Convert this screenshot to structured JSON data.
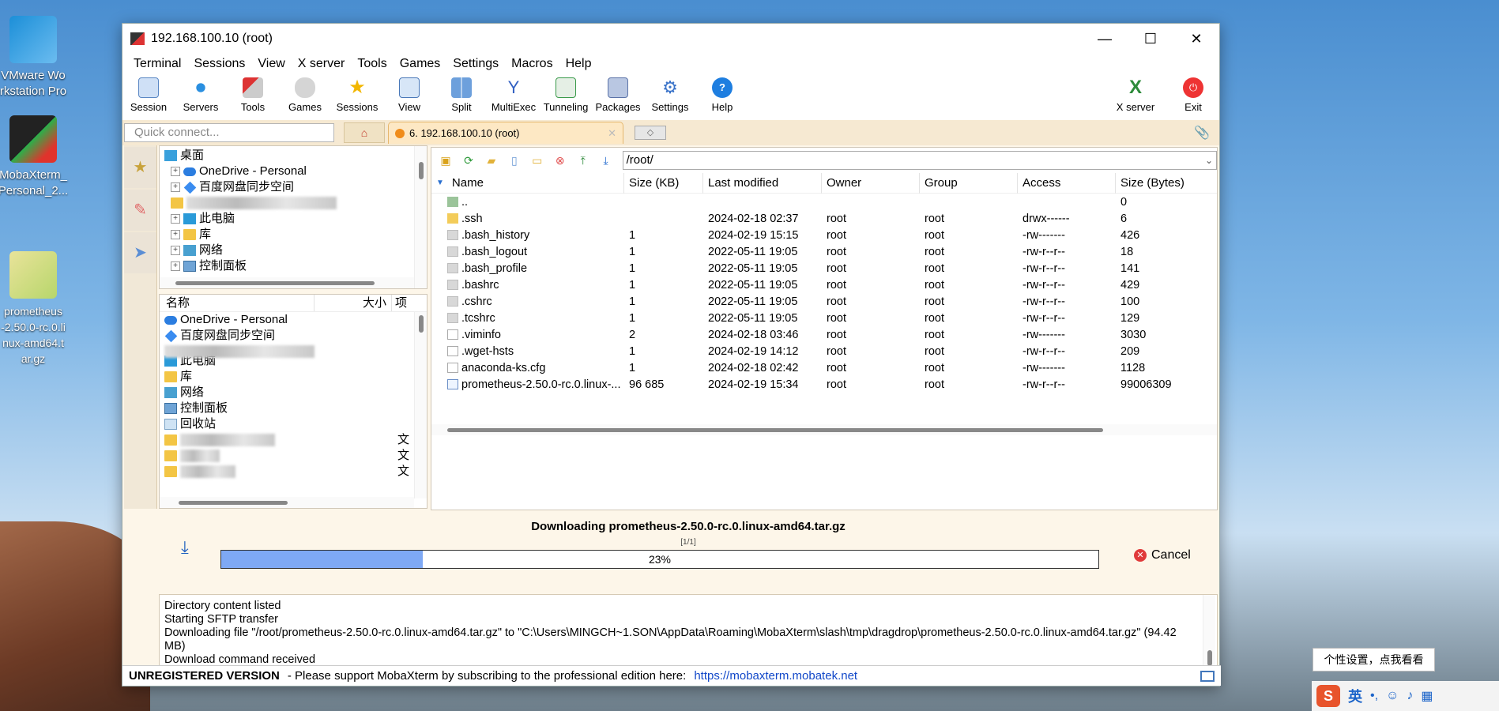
{
  "desktop": {
    "icons": [
      {
        "label": "VMware Wo\nrkstation Pro"
      },
      {
        "label": "MobaXterm_\nPersonal_2..."
      },
      {
        "label": "prometheus\n-2.50.0-rc.0.li\nnux-amd64.t\nar.gz"
      }
    ],
    "tray_tip": "个性设置，点我看看",
    "tray_lang": "英"
  },
  "window": {
    "title": "192.168.100.10 (root)",
    "menu": [
      "Terminal",
      "Sessions",
      "View",
      "X server",
      "Tools",
      "Games",
      "Settings",
      "Macros",
      "Help"
    ],
    "toolbar": [
      "Session",
      "Servers",
      "Tools",
      "Games",
      "Sessions",
      "View",
      "Split",
      "MultiExec",
      "Tunneling",
      "Packages",
      "Settings",
      "Help"
    ],
    "toolbar_right": [
      "X server",
      "Exit"
    ],
    "quick_connect_placeholder": "Quick connect...",
    "session_tab": "6. 192.168.100.10 (root)"
  },
  "left_tree": {
    "items": [
      {
        "label": "桌面",
        "icon": "desktop"
      },
      {
        "label": "OneDrive - Personal",
        "icon": "cloud"
      },
      {
        "label": "百度网盘同步空间",
        "icon": "baidu"
      },
      {
        "label": "此电脑",
        "icon": "pc"
      },
      {
        "label": "库",
        "icon": "folder"
      },
      {
        "label": "网络",
        "icon": "network"
      },
      {
        "label": "控制面板",
        "icon": "control-panel"
      }
    ]
  },
  "left_list": {
    "headers": [
      "名称",
      "大小",
      "项"
    ],
    "items": [
      {
        "label": "OneDrive - Personal",
        "icon": "cloud"
      },
      {
        "label": "百度网盘同步空间",
        "icon": "baidu"
      },
      {
        "label": "此电脑",
        "icon": "pc"
      },
      {
        "label": "库",
        "icon": "folder"
      },
      {
        "label": "网络",
        "icon": "network"
      },
      {
        "label": "控制面板",
        "icon": "control-panel"
      },
      {
        "label": "回收站",
        "icon": "recycle-bin"
      }
    ],
    "trailing_chars": [
      "文",
      "文",
      "文"
    ]
  },
  "file_browser": {
    "path": "/root/",
    "columns": [
      "Name",
      "Size (KB)",
      "Last modified",
      "Owner",
      "Group",
      "Access",
      "Size (Bytes)"
    ],
    "rows": [
      {
        "name": "..",
        "size": "",
        "modified": "",
        "owner": "",
        "group": "",
        "access": "",
        "bytes": "0",
        "icon": "up"
      },
      {
        "name": ".ssh",
        "size": "",
        "modified": "2024-02-18 02:37",
        "owner": "root",
        "group": "root",
        "access": "drwx------",
        "bytes": "6",
        "icon": "folder"
      },
      {
        "name": ".bash_history",
        "size": "1",
        "modified": "2024-02-19 15:15",
        "owner": "root",
        "group": "root",
        "access": "-rw-------",
        "bytes": "426",
        "icon": "file"
      },
      {
        "name": ".bash_logout",
        "size": "1",
        "modified": "2022-05-11 19:05",
        "owner": "root",
        "group": "root",
        "access": "-rw-r--r--",
        "bytes": "18",
        "icon": "file"
      },
      {
        "name": ".bash_profile",
        "size": "1",
        "modified": "2022-05-11 19:05",
        "owner": "root",
        "group": "root",
        "access": "-rw-r--r--",
        "bytes": "141",
        "icon": "file"
      },
      {
        "name": ".bashrc",
        "size": "1",
        "modified": "2022-05-11 19:05",
        "owner": "root",
        "group": "root",
        "access": "-rw-r--r--",
        "bytes": "429",
        "icon": "file"
      },
      {
        "name": ".cshrc",
        "size": "1",
        "modified": "2022-05-11 19:05",
        "owner": "root",
        "group": "root",
        "access": "-rw-r--r--",
        "bytes": "100",
        "icon": "file"
      },
      {
        "name": ".tcshrc",
        "size": "1",
        "modified": "2022-05-11 19:05",
        "owner": "root",
        "group": "root",
        "access": "-rw-r--r--",
        "bytes": "129",
        "icon": "file"
      },
      {
        "name": ".viminfo",
        "size": "2",
        "modified": "2024-02-18 03:46",
        "owner": "root",
        "group": "root",
        "access": "-rw-------",
        "bytes": "3030",
        "icon": "doc"
      },
      {
        "name": ".wget-hsts",
        "size": "1",
        "modified": "2024-02-19 14:12",
        "owner": "root",
        "group": "root",
        "access": "-rw-r--r--",
        "bytes": "209",
        "icon": "doc"
      },
      {
        "name": "anaconda-ks.cfg",
        "size": "1",
        "modified": "2024-02-18 02:42",
        "owner": "root",
        "group": "root",
        "access": "-rw-------",
        "bytes": "1128",
        "icon": "doc"
      },
      {
        "name": "prometheus-2.50.0-rc.0.linux-...",
        "size": "96 685",
        "modified": "2024-02-19 15:34",
        "owner": "root",
        "group": "root",
        "access": "-rw-r--r--",
        "bytes": "99006309",
        "icon": "archive"
      }
    ]
  },
  "download": {
    "title": "Downloading prometheus-2.50.0-rc.0.linux-amd64.tar.gz",
    "step": "[1/1]",
    "percent_label": "23%",
    "progress": 0.23,
    "cancel_label": "Cancel"
  },
  "log": [
    "Directory content listed",
    "Starting SFTP transfer",
    "Downloading file \"/root/prometheus-2.50.0-rc.0.linux-amd64.tar.gz\" to \"C:\\Users\\MINGCH~1.SON\\AppData\\Roaming\\MobaXterm\\slash\\tmp\\dragdrop\\prometheus-2.50.0-rc.0.linux-amd64.tar.gz\" (94.42 MB)",
    "Download command received"
  ],
  "statusbar": {
    "unregistered": "UNREGISTERED VERSION",
    "message": "-  Please support MobaXterm by subscribing to the professional edition here:",
    "link": "https://mobaxterm.mobatek.net"
  }
}
